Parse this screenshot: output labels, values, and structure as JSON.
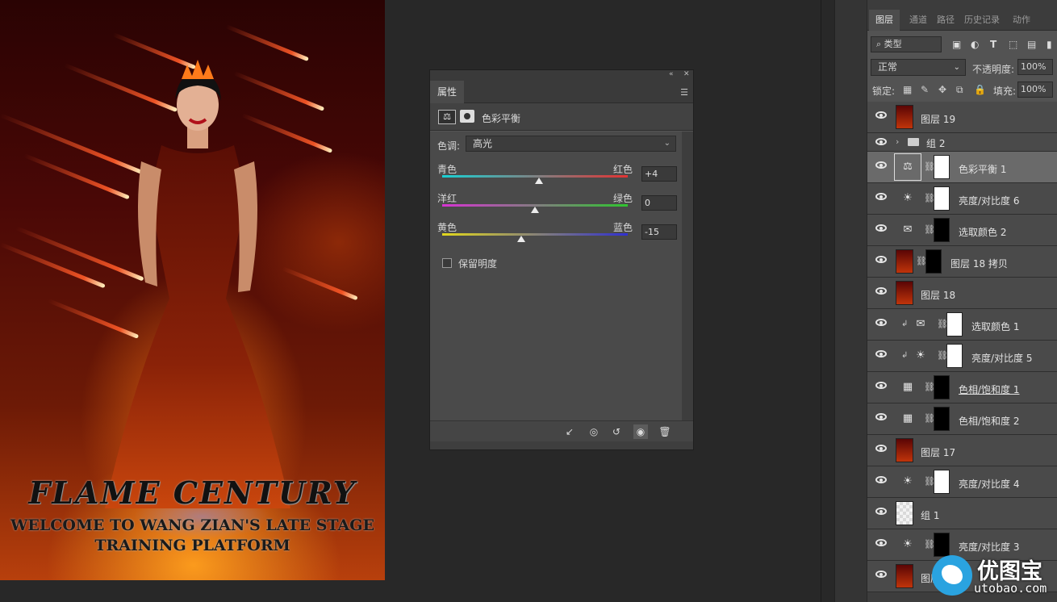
{
  "document": {
    "title": "FLAME CENTURY",
    "subtitle_line1": "WELCOME TO WANG ZIAN'S LATE STAGE",
    "subtitle_line2": "TRAINING PLATFORM"
  },
  "properties": {
    "tab": "属性",
    "adjustment_title": "色彩平衡",
    "tone_label": "色调:",
    "tone_value": "高光",
    "sliders": [
      {
        "left": "青色",
        "right": "红色",
        "value": "+4",
        "level": 4
      },
      {
        "left": "洋红",
        "right": "绿色",
        "value": "0",
        "level": 0
      },
      {
        "left": "黄色",
        "right": "蓝色",
        "value": "-15",
        "level": -15
      }
    ],
    "preserve_luminosity": "保留明度",
    "preserve_checked": false
  },
  "layers_panel": {
    "tabs": [
      "图层",
      "通道",
      "路径",
      "历史记录",
      "动作"
    ],
    "active_tab": "图层",
    "filter_label": "类型",
    "blend_mode": "正常",
    "opacity_label": "不透明度:",
    "opacity_value": "100%",
    "lock_label": "锁定:",
    "fill_label": "填充:",
    "fill_value": "100%",
    "layers": [
      {
        "name": "图层 19",
        "kind": "image"
      },
      {
        "name": "组 2",
        "kind": "group"
      },
      {
        "name": "色彩平衡 1",
        "kind": "adjustment",
        "icon": "balance",
        "mask": "white",
        "selected": true
      },
      {
        "name": "亮度/对比度 6",
        "kind": "adjustment",
        "icon": "sun",
        "mask": "white"
      },
      {
        "name": "选取颜色 2",
        "kind": "adjustment",
        "icon": "selective",
        "mask": "black"
      },
      {
        "name": "图层 18 拷贝",
        "kind": "image-mask",
        "mask": "black"
      },
      {
        "name": "图层 18",
        "kind": "image"
      },
      {
        "name": "选取颜色 1",
        "kind": "adjustment",
        "icon": "selective",
        "mask": "white",
        "clipped": true
      },
      {
        "name": "亮度/对比度 5",
        "kind": "adjustment",
        "icon": "sun",
        "mask": "white",
        "clipped": true
      },
      {
        "name": "色相/饱和度 1",
        "kind": "adjustment",
        "icon": "hue",
        "mask": "black",
        "underline": true
      },
      {
        "name": "色相/饱和度 2",
        "kind": "adjustment",
        "icon": "hue",
        "mask": "black"
      },
      {
        "name": "图层 17",
        "kind": "image"
      },
      {
        "name": "亮度/对比度 4",
        "kind": "adjustment",
        "icon": "sun",
        "mask": "white"
      },
      {
        "name": "组 1",
        "kind": "checker"
      },
      {
        "name": "亮度/对比度 3",
        "kind": "adjustment",
        "icon": "sun",
        "mask": "black"
      },
      {
        "name": "图层 16",
        "kind": "image"
      }
    ]
  },
  "watermark": {
    "title": "优图宝",
    "url": "utobao.com"
  }
}
